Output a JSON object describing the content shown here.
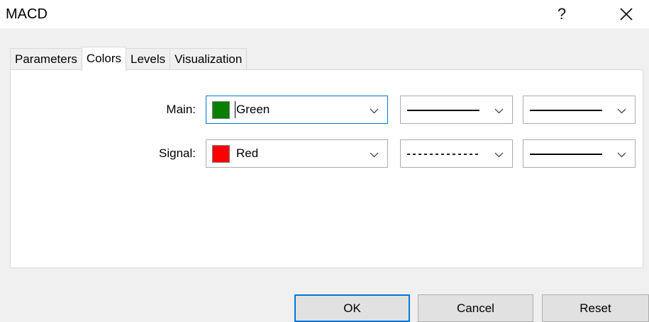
{
  "window": {
    "title": "MACD",
    "help_label": "?",
    "close_icon": "close-icon"
  },
  "tabs": [
    {
      "label": "Parameters",
      "active": false
    },
    {
      "label": "Colors",
      "active": true
    },
    {
      "label": "Levels",
      "active": false
    },
    {
      "label": "Visualization",
      "active": false
    }
  ],
  "colors": {
    "rows": [
      {
        "label": "Main:",
        "color_name": "Green",
        "color_hex": "#087f00",
        "line_style": "solid",
        "line_width": "thin"
      },
      {
        "label": "Signal:",
        "color_name": "Red",
        "color_hex": "#ff0000",
        "line_style": "dotted",
        "line_width": "thin"
      }
    ]
  },
  "buttons": {
    "ok": "OK",
    "cancel": "Cancel",
    "reset": "Reset"
  },
  "theme": {
    "focus": "#0078d7",
    "button_bg": "#e1e1e1",
    "dialog_bg": "#f0f0f0",
    "panel_bg": "#ffffff"
  }
}
